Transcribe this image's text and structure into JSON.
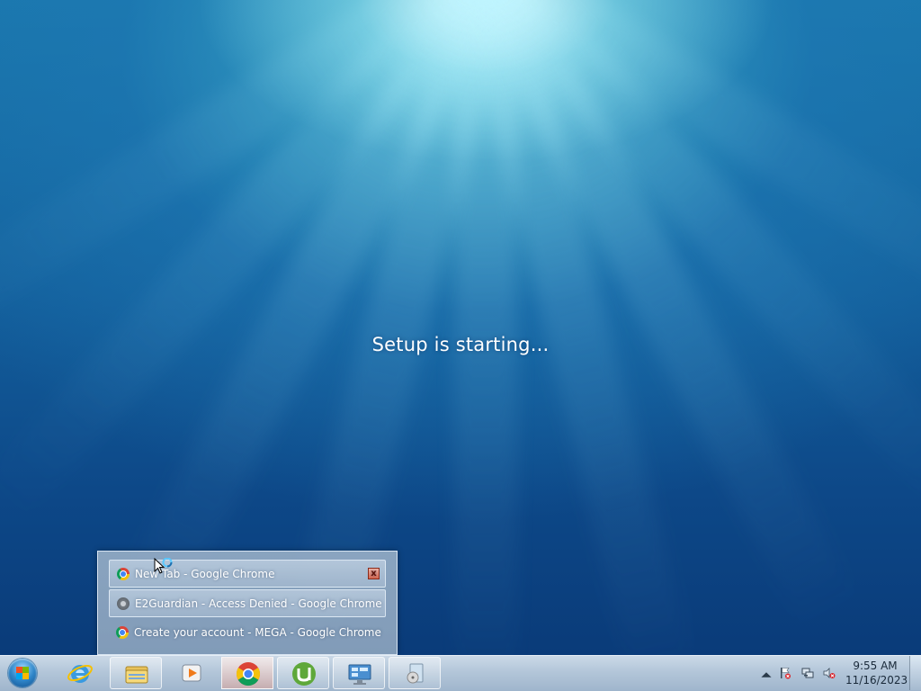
{
  "desktop": {
    "status_message": "Setup is starting..."
  },
  "jumplist": {
    "items": [
      {
        "label": "New Tab - Google Chrome",
        "icon": "chrome-icon",
        "highlighted": true
      },
      {
        "label": "E2Guardian - Access Denied - Google Chrome",
        "icon": "globe-grey-icon",
        "highlighted": true
      },
      {
        "label": "Create your account - MEGA - Google Chrome",
        "icon": "chrome-icon",
        "highlighted": false
      }
    ],
    "close_glyph": "x"
  },
  "taskbar": {
    "pinned": [
      {
        "name": "start-button",
        "icon": "windows-logo-icon"
      },
      {
        "name": "internet-explorer",
        "icon": "internet-explorer-icon"
      },
      {
        "name": "windows-explorer",
        "icon": "folder-icon"
      },
      {
        "name": "windows-media-player",
        "icon": "media-player-icon"
      },
      {
        "name": "google-chrome",
        "icon": "chrome-icon",
        "active": true
      },
      {
        "name": "utorrent",
        "icon": "utorrent-icon"
      },
      {
        "name": "remote-desktop",
        "icon": "remote-desktop-icon"
      },
      {
        "name": "media-center",
        "icon": "media-icon"
      }
    ],
    "tray": {
      "icons": [
        "show-hidden-icons-arrow",
        "action-center-flag-icon",
        "network-icon",
        "volume-muted-icon"
      ],
      "time": "9:55 AM",
      "date": "11/16/2023"
    }
  },
  "colors": {
    "desktop_top": "#1a78ad",
    "desktop_bottom": "#0a3b79",
    "taskbar": "#afc3d7",
    "text_white": "#ffffff"
  }
}
